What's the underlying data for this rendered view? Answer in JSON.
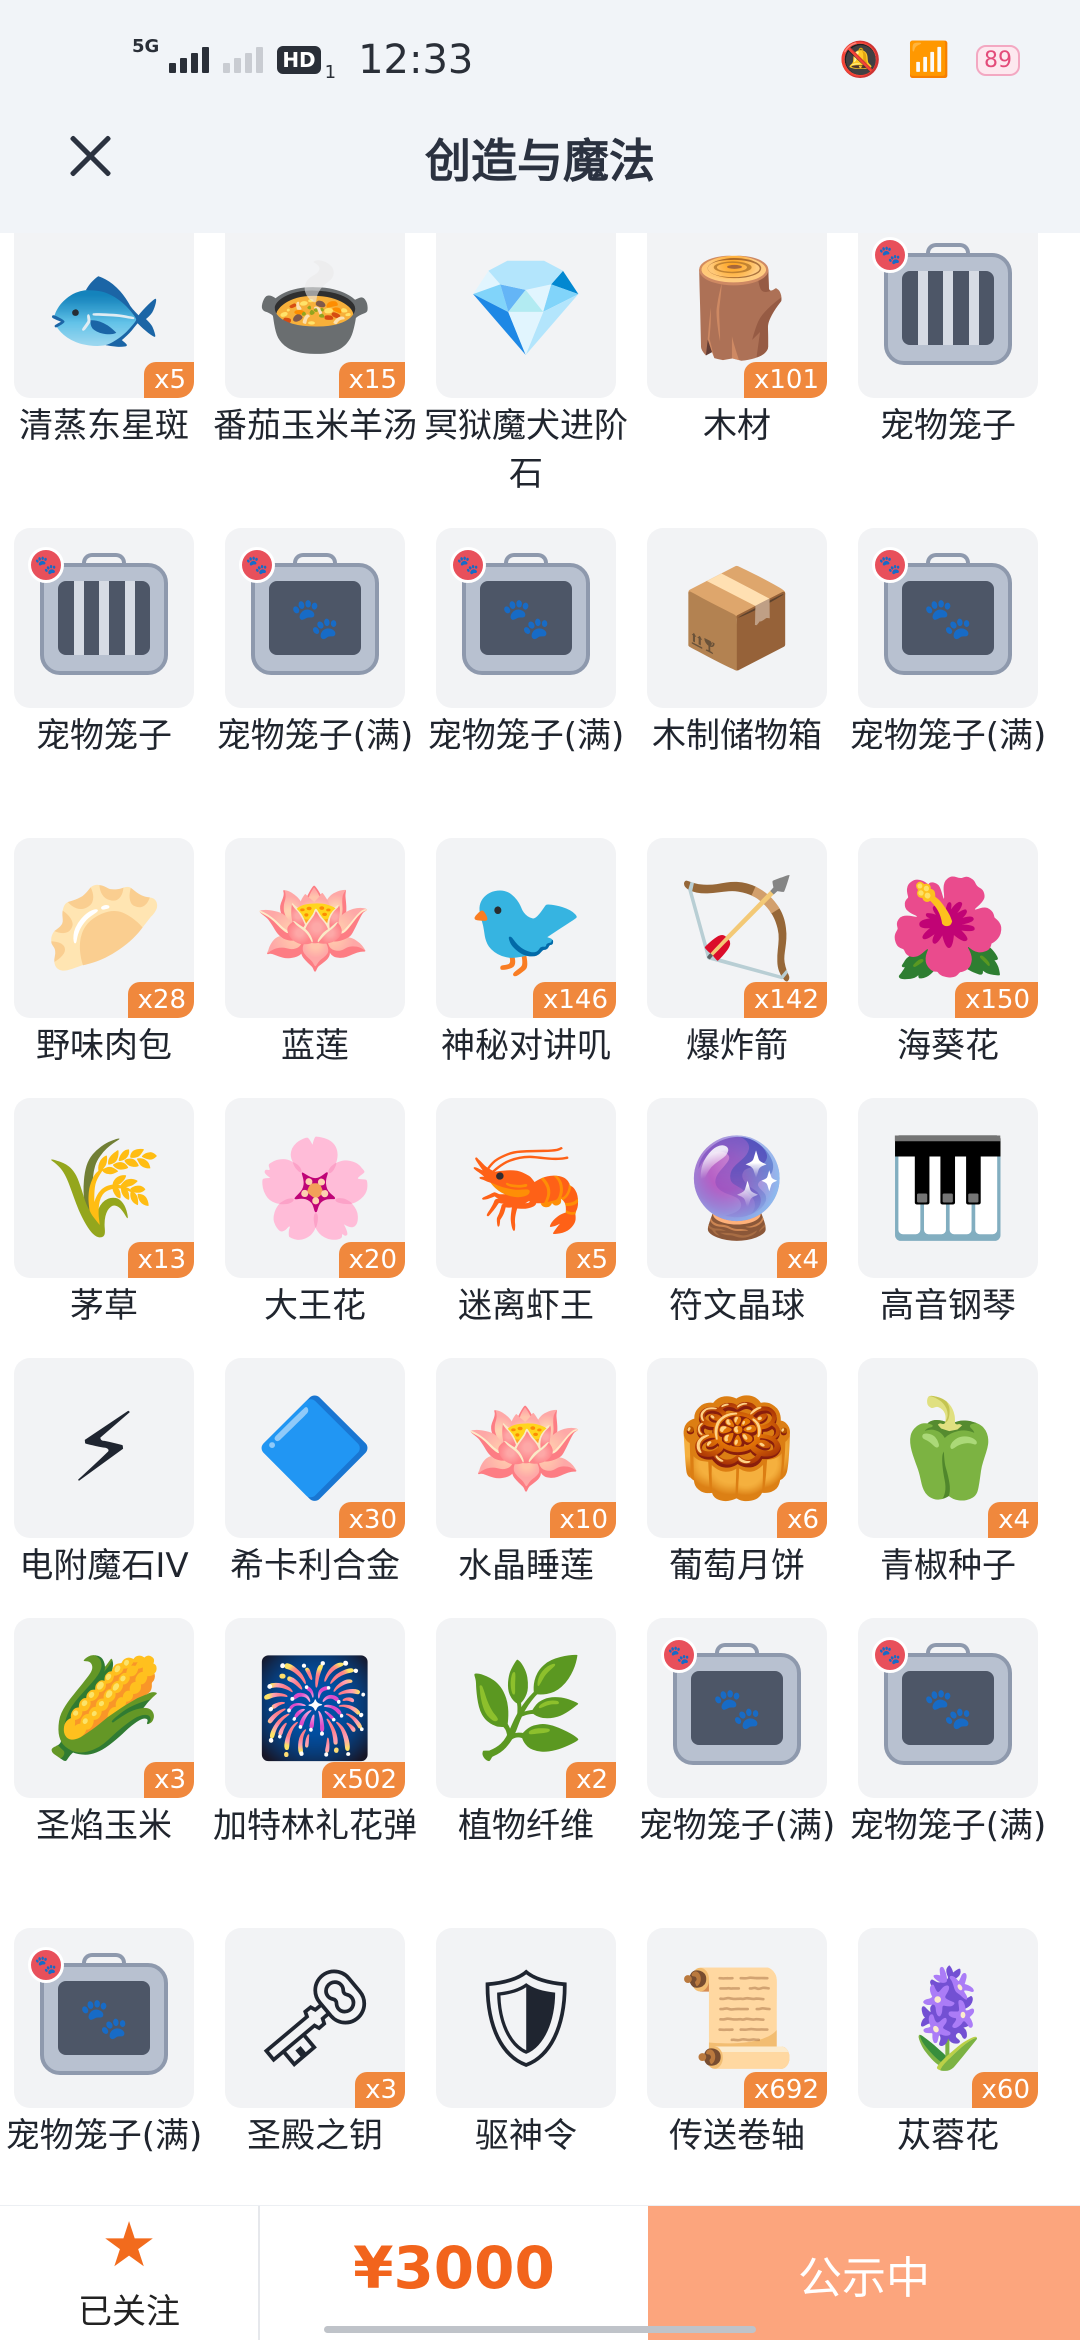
{
  "status_bar": {
    "network": "5G",
    "hd": "HD",
    "sim": "1",
    "time": "12:33",
    "battery": "89"
  },
  "header": {
    "title": "创造与魔法"
  },
  "items": [
    {
      "name": "清蒸东星斑",
      "qty": "x5",
      "icon": "fish-dish-icon"
    },
    {
      "name": "番茄玉米羊汤",
      "qty": "x15",
      "icon": "soup-bowl-icon"
    },
    {
      "name": "冥狱魔犬进阶石",
      "qty": "",
      "icon": "gem-icon"
    },
    {
      "name": "木材",
      "qty": "x101",
      "icon": "log-icon"
    },
    {
      "name": "宠物笼子",
      "qty": "",
      "icon": "pet-cage-icon"
    },
    {
      "name": "宠物笼子",
      "qty": "",
      "icon": "pet-cage-icon"
    },
    {
      "name": "宠物笼子(满)",
      "qty": "",
      "icon": "pet-cage-full-icon"
    },
    {
      "name": "宠物笼子(满)",
      "qty": "",
      "icon": "pet-cage-full-icon"
    },
    {
      "name": "木制储物箱",
      "qty": "",
      "icon": "wooden-box-icon"
    },
    {
      "name": "宠物笼子(满)",
      "qty": "",
      "icon": "pet-cage-full-icon"
    },
    {
      "name": "野味肉包",
      "qty": "x28",
      "icon": "bun-basket-icon"
    },
    {
      "name": "蓝莲",
      "qty": "",
      "icon": "blue-lotus-icon"
    },
    {
      "name": "神秘对讲叽",
      "qty": "x146",
      "icon": "walkie-bird-icon"
    },
    {
      "name": "爆炸箭",
      "qty": "x142",
      "icon": "arrows-icon"
    },
    {
      "name": "海葵花",
      "qty": "x150",
      "icon": "anemone-flower-icon"
    },
    {
      "name": "茅草",
      "qty": "x13",
      "icon": "thatch-icon"
    },
    {
      "name": "大王花",
      "qty": "x20",
      "icon": "rafflesia-icon"
    },
    {
      "name": "迷离虾王",
      "qty": "x5",
      "icon": "shrimp-icon"
    },
    {
      "name": "符文晶球",
      "qty": "x4",
      "icon": "rune-orb-icon"
    },
    {
      "name": "高音钢琴",
      "qty": "",
      "icon": "piano-icon"
    },
    {
      "name": "电附魔石IV",
      "qty": "",
      "icon": "lightning-gem-icon"
    },
    {
      "name": "希卡利合金",
      "qty": "x30",
      "icon": "alloy-bar-icon"
    },
    {
      "name": "水晶睡莲",
      "qty": "x10",
      "icon": "crystal-lotus-icon"
    },
    {
      "name": "葡萄月饼",
      "qty": "x6",
      "icon": "mooncake-icon"
    },
    {
      "name": "青椒种子",
      "qty": "x4",
      "icon": "seed-bag-icon"
    },
    {
      "name": "圣焰玉米",
      "qty": "x3",
      "icon": "corn-icon"
    },
    {
      "name": "加特林礼花弹",
      "qty": "x502",
      "icon": "firework-icon"
    },
    {
      "name": "植物纤维",
      "qty": "x2",
      "icon": "fiber-icon"
    },
    {
      "name": "宠物笼子(满)",
      "qty": "",
      "icon": "pet-cage-full-icon"
    },
    {
      "name": "宠物笼子(满)",
      "qty": "",
      "icon": "pet-cage-full-icon"
    },
    {
      "name": "宠物笼子(满)",
      "qty": "",
      "icon": "pet-cage-full-icon"
    },
    {
      "name": "圣殿之钥",
      "qty": "x3",
      "icon": "key-icon"
    },
    {
      "name": "驱神令",
      "qty": "",
      "icon": "emblem-icon"
    },
    {
      "name": "传送卷轴",
      "qty": "x692",
      "icon": "scroll-icon"
    },
    {
      "name": "苁蓉花",
      "qty": "x60",
      "icon": "cistanche-flower-icon"
    }
  ],
  "bottom_bar": {
    "follow_label": "已关注",
    "price": "¥3000",
    "cta_label": "公示中"
  },
  "colors": {
    "accent": "#f2641c",
    "cta_bg": "#fca57d",
    "qty_badge": "#f0883d",
    "header_bg": "#f1f4f8"
  }
}
